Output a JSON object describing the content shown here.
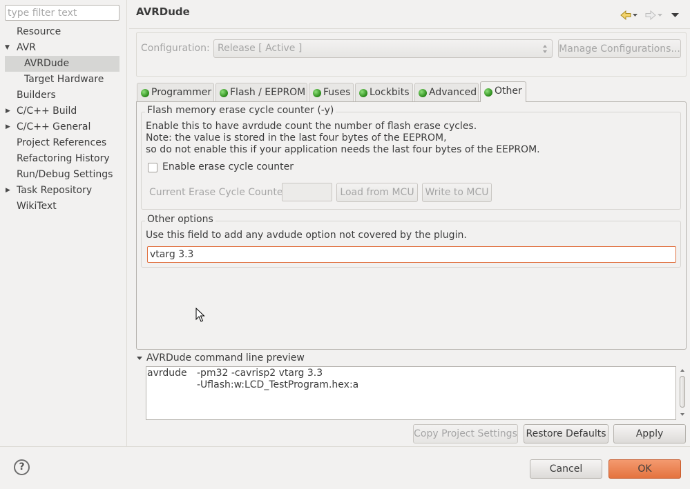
{
  "sidebar": {
    "filter_placeholder": "type filter text",
    "items": [
      {
        "label": "Resource"
      },
      {
        "label": "AVR"
      },
      {
        "label": "AVRDude"
      },
      {
        "label": "Target Hardware"
      },
      {
        "label": "Builders"
      },
      {
        "label": "C/C++ Build"
      },
      {
        "label": "C/C++ General"
      },
      {
        "label": "Project References"
      },
      {
        "label": "Refactoring History"
      },
      {
        "label": "Run/Debug Settings"
      },
      {
        "label": "Task Repository"
      },
      {
        "label": "WikiText"
      }
    ]
  },
  "header": {
    "title": "AVRDude"
  },
  "config": {
    "label": "Configuration:",
    "value": "Release  [ Active ]",
    "manage_label": "Manage Configurations..."
  },
  "tabs": [
    {
      "label": "Programmer"
    },
    {
      "label": "Flash / EEPROM"
    },
    {
      "label": "Fuses"
    },
    {
      "label": "Lockbits"
    },
    {
      "label": "Advanced"
    },
    {
      "label": "Other"
    }
  ],
  "flash_group": {
    "title": "Flash memory erase cycle counter (-y)",
    "desc_line1": "Enable this to have avrdude count the number of flash erase cycles.",
    "desc_line2": "Note: the value is stored in the last four bytes of the EEPROM,",
    "desc_line3": "so do not enable this if your application needs the last four bytes of the EEPROM.",
    "checkbox_label": "Enable erase cycle counter",
    "counter_label": "Current Erase Cycle Counter",
    "counter_value": "",
    "load_label": "Load from MCU",
    "write_label": "Write to MCU"
  },
  "other_group": {
    "title": "Other options",
    "desc": "Use this field to add any avdude option not covered by the plugin.",
    "value": "vtarg 3.3"
  },
  "preview": {
    "title": "AVRDude command line preview",
    "command": "avrdude",
    "args_line1": "-pm32 -cavrisp2 vtarg 3.3",
    "args_line2": "-Uflash:w:LCD_TestProgram.hex:a"
  },
  "actions": {
    "copy_label": "Copy Project Settings",
    "restore_label": "Restore Defaults",
    "apply_label": "Apply"
  },
  "footer": {
    "help_glyph": "?",
    "cancel_label": "Cancel",
    "ok_label": "OK"
  },
  "colors": {
    "ok_button": "#e4733f",
    "focus_border": "#e0703f",
    "selected_item_bg": "#d6d6d4",
    "status_dot": "#2f8f1e"
  }
}
